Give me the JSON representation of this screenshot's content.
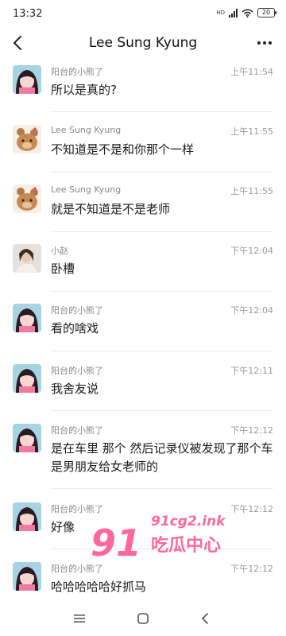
{
  "status_bar": {
    "time": "13:32",
    "network_tag": "HD",
    "battery": "20"
  },
  "header": {
    "title": "Lee Sung Kyung",
    "back_icon": "chevron-left-icon",
    "more_icon": "more-dots-icon"
  },
  "messages": [
    {
      "sender": "阳台的小熊了",
      "time": "上午11:54",
      "text": "所以是真的?",
      "avatar": "anime-girl"
    },
    {
      "sender": "Lee Sung Kyung",
      "time": "上午11:55",
      "text": "不知道是不是和你那个一样",
      "avatar": "bear"
    },
    {
      "sender": "Lee Sung Kyung",
      "time": "上午11:55",
      "text": "就是不知道是不是老师",
      "avatar": "bear"
    },
    {
      "sender": "小赵",
      "time": "下午12:04",
      "text": "卧槽",
      "avatar": "photo"
    },
    {
      "sender": "阳台的小熊了",
      "time": "下午12:04",
      "text": "看的啥戏",
      "avatar": "anime-girl"
    },
    {
      "sender": "阳台的小熊了",
      "time": "下午12:11",
      "text": "我舍友说",
      "avatar": "anime-girl"
    },
    {
      "sender": "阳台的小熊了",
      "time": "下午12:12",
      "text": "是在车里 那个 然后记录仪被发现了那个车是男朋友给女老师的",
      "avatar": "anime-girl"
    },
    {
      "sender": "阳台的小熊了",
      "time": "下午12:12",
      "text": "好像",
      "avatar": "anime-girl"
    },
    {
      "sender": "阳台的小熊了",
      "time": "下午12:12",
      "text": "哈哈哈哈哈好抓马",
      "avatar": "anime-girl"
    }
  ],
  "watermark": {
    "big": "91",
    "domain": "91cg2.ink",
    "name": "吃瓜中心"
  },
  "nav": {
    "menu_icon": "menu-icon",
    "home_icon": "home-square-icon",
    "back_icon": "back-triangle-icon"
  }
}
